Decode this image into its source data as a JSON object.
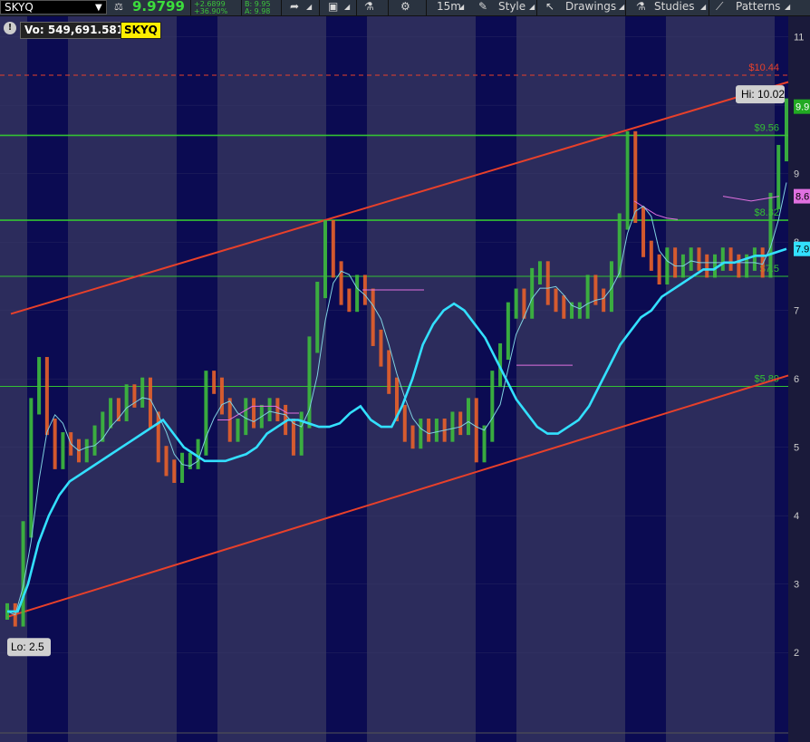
{
  "toolbar": {
    "symbol": "SKYQ",
    "last_price": "9.9799",
    "net_change": "+2.6899",
    "pct_change": "+36.90%",
    "bid": "B: 9.95",
    "ask": "A: 9.98",
    "timeframe": "15m",
    "style_label": "Style",
    "drawings_label": "Drawings",
    "studies_label": "Studies",
    "patterns_label": "Patterns"
  },
  "chart_header": {
    "volume_label": "Vo: 549,691.5819",
    "symbol_tag": "SKYQ",
    "info_glyph": "!"
  },
  "colors": {
    "background_light": "#2c2c5c",
    "background_dark": "#0b0b52",
    "grid": "#3a3a6a",
    "channel_line": "#e8402a",
    "resistance_line": "#33c033",
    "dashed_line": "#e8402a",
    "ema_fast": "#33e0ff",
    "ema_slow": "#7fd0e0",
    "vwap": "#e070e0"
  },
  "chart_data": {
    "type": "line",
    "ylim": [
      1.5,
      11.3
    ],
    "yticks": [
      2,
      3,
      4,
      5,
      6,
      7,
      8,
      9,
      10,
      11
    ],
    "ytick_labels": [
      "2",
      "3",
      "4",
      "5",
      "6",
      "7",
      "8",
      "9",
      "",
      "11"
    ],
    "hi_label": "Hi: 10.02",
    "lo_label": "Lo: 2.5",
    "horizontal_levels": [
      {
        "value": 10.44,
        "label": "$10.44",
        "style": "dashed",
        "color": "#e8402a"
      },
      {
        "value": 9.56,
        "label": "$9.56",
        "style": "solid",
        "color": "#33c033"
      },
      {
        "value": 8.32,
        "label": "$8.32",
        "style": "solid",
        "color": "#33c033"
      },
      {
        "value": 7.5,
        "label": "$7.5",
        "style": "thin",
        "color": "#33c033"
      },
      {
        "value": 5.89,
        "label": "$5.89",
        "style": "thin",
        "color": "#33c033"
      }
    ],
    "price_badges": [
      {
        "value": 9.98,
        "label": "9.9",
        "color": "#22aa22"
      },
      {
        "value": 8.67,
        "label": "8.6",
        "color": "#e070e0"
      },
      {
        "value": 7.9,
        "label": "7.9",
        "color": "#33e0ff"
      }
    ],
    "sessions": 25,
    "close_series": [
      2.6,
      2.5,
      3.8,
      5.6,
      6.2,
      5.3,
      4.8,
      5.1,
      5.0,
      4.9,
      5.0,
      5.2,
      5.4,
      5.6,
      5.5,
      5.8,
      5.7,
      5.9,
      5.4,
      4.9,
      4.7,
      4.6,
      4.8,
      4.8,
      5.0,
      6.0,
      5.9,
      5.6,
      5.2,
      5.3,
      5.6,
      5.4,
      5.5,
      5.6,
      5.5,
      5.3,
      5.0,
      5.4,
      6.5,
      7.3,
      8.2,
      7.6,
      7.2,
      7.1,
      7.4,
      7.2,
      6.6,
      6.3,
      5.9,
      5.5,
      5.2,
      5.1,
      5.3,
      5.2,
      5.3,
      5.2,
      5.4,
      5.3,
      5.6,
      4.9,
      5.2,
      6.0,
      6.4,
      7.0,
      7.2,
      7.0,
      7.5,
      7.6,
      7.2,
      7.1,
      7.0,
      7.0,
      7.0,
      7.4,
      7.2,
      7.1,
      7.6,
      8.3,
      9.5,
      8.4,
      7.9,
      7.7,
      7.5,
      7.8,
      7.6,
      7.7,
      7.8,
      7.7,
      7.6,
      7.7,
      7.8,
      7.7,
      7.6,
      7.7,
      7.8,
      7.6,
      8.6,
      9.3,
      9.98
    ],
    "ema_fast_series": [
      2.6,
      2.6,
      3.0,
      3.6,
      4.0,
      4.3,
      4.5,
      4.6,
      4.7,
      4.8,
      4.9,
      5.0,
      5.1,
      5.2,
      5.3,
      5.4,
      5.2,
      5.0,
      4.9,
      4.8,
      4.8,
      4.8,
      4.85,
      4.9,
      5.0,
      5.2,
      5.3,
      5.4,
      5.4,
      5.35,
      5.3,
      5.3,
      5.35,
      5.5,
      5.6,
      5.4,
      5.3,
      5.3,
      5.6,
      6.0,
      6.5,
      6.8,
      7.0,
      7.1,
      7.0,
      6.8,
      6.6,
      6.3,
      6.0,
      5.7,
      5.5,
      5.3,
      5.2,
      5.2,
      5.3,
      5.4,
      5.6,
      5.9,
      6.2,
      6.5,
      6.7,
      6.9,
      7.0,
      7.2,
      7.3,
      7.4,
      7.5,
      7.6,
      7.6,
      7.7,
      7.7,
      7.75,
      7.8,
      7.8,
      7.85,
      7.9
    ],
    "vwap_segments": [
      [
        5.4,
        5.4,
        5.5,
        5.6,
        5.6,
        5.6,
        5.5,
        5.5
      ],
      [
        7.3,
        7.3,
        7.3,
        7.3,
        7.3
      ],
      [
        6.2,
        6.2,
        6.2,
        6.2
      ],
      [
        8.6,
        8.5,
        8.4,
        8.35,
        8.33
      ],
      [
        8.67,
        8.6,
        8.67
      ]
    ],
    "channel_upper": [
      6.95,
      10.34
    ],
    "channel_lower": [
      2.52,
      6.05
    ]
  }
}
